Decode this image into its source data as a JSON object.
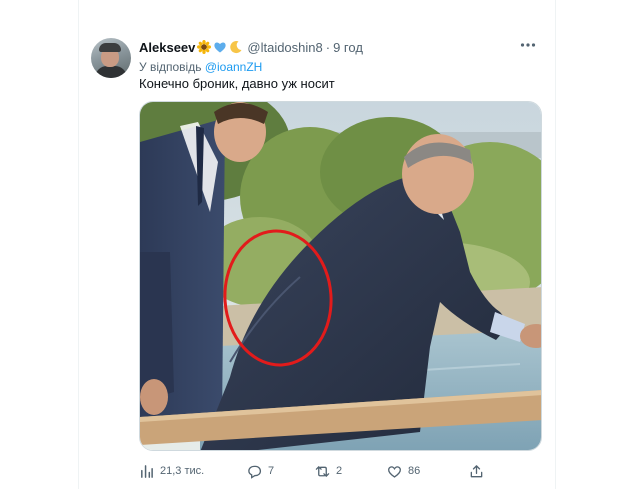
{
  "tweet": {
    "author_name": "Alekseev",
    "author_emojis": [
      "sunflower-emoji",
      "blue-heart-emoji",
      "crescent-moon-emoji"
    ],
    "handle": "@ltaidoshin8",
    "separator": "·",
    "time": "9 год",
    "reply_prefix": "У відповідь",
    "reply_mention": "@ioannZH",
    "text": "Конечно броник, давно уж носит",
    "more_icon": "more-horizontal-icon",
    "media": {
      "annotation_color": "#e21b1b"
    }
  },
  "actions": {
    "views": {
      "icon": "bar-chart-icon",
      "count": "21,3 тис."
    },
    "replies": {
      "icon": "reply-bubble-icon",
      "count": "7"
    },
    "retweets": {
      "icon": "retweet-icon",
      "count": "2"
    },
    "likes": {
      "icon": "heart-icon",
      "count": "86"
    },
    "share": {
      "icon": "share-icon"
    }
  },
  "colors": {
    "text_primary": "#0f1419",
    "text_secondary": "#536471",
    "link": "#1d9bf0",
    "border": "#cfd9de"
  }
}
